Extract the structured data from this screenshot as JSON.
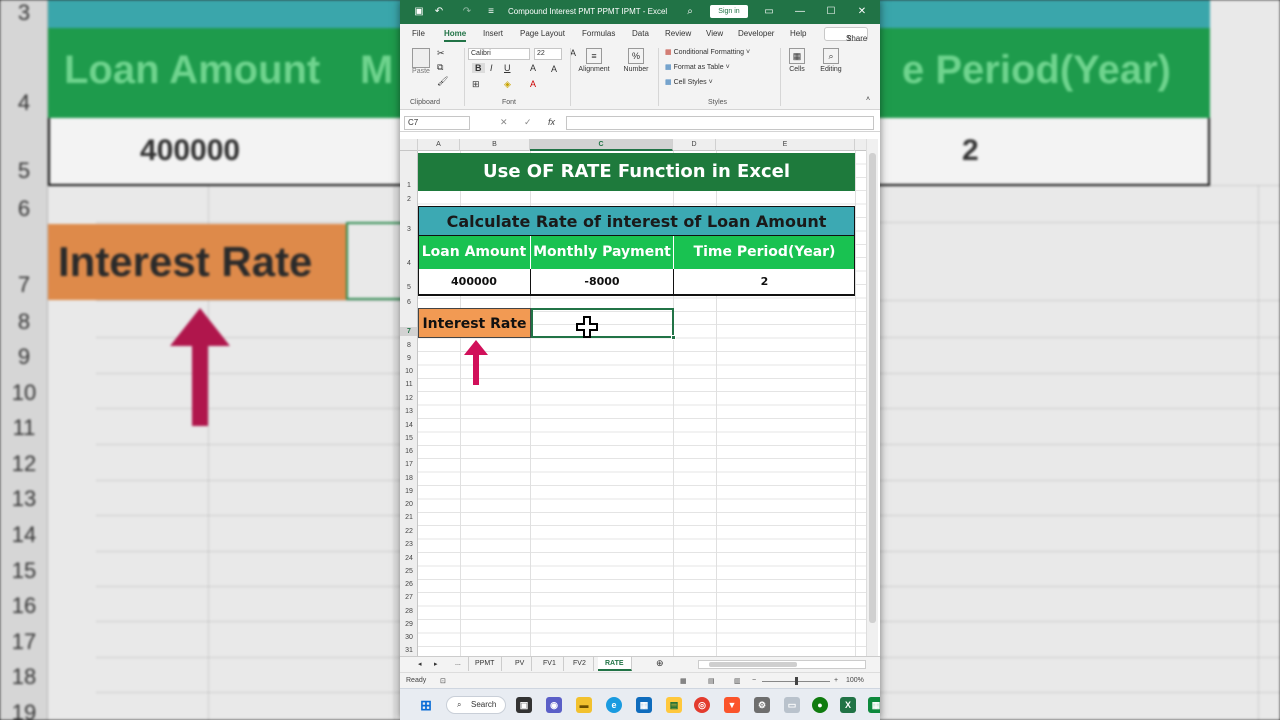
{
  "background": {
    "row_numbers": [
      "3",
      "4",
      "5",
      "6",
      "7",
      "8",
      "9",
      "10",
      "11",
      "12",
      "13",
      "14",
      "15",
      "16",
      "17",
      "18",
      "19"
    ],
    "headers": {
      "loan_amount": "Loan Amount",
      "monthly_partial": "M",
      "time_period_partial": "e Period(Year)"
    },
    "values": {
      "loan_amount": "400000",
      "time_period": "2"
    },
    "interest_label": "Interest Rate"
  },
  "window": {
    "title": "Compound Interest PMT PPMT IPMT  -  Excel",
    "sign_in": "Sign in",
    "menu": [
      "File",
      "Home",
      "Insert",
      "Page Layout",
      "Formulas",
      "Data",
      "Review",
      "View",
      "Developer",
      "Help"
    ],
    "active_menu": "Home",
    "share": "Share"
  },
  "ribbon": {
    "paste": "Paste",
    "clipboard": "Clipboard",
    "font_name": "Calibri",
    "font_size": "22",
    "font": "Font",
    "alignment": "Alignment",
    "number": "Number",
    "conditional_formatting": "Conditional Formatting",
    "format_as_table": "Format as Table",
    "cell_styles": "Cell Styles",
    "styles": "Styles",
    "cells": "Cells",
    "editing": "Editing"
  },
  "formula_bar": {
    "name_box": "C7",
    "fx": "fx",
    "value": ""
  },
  "columns": [
    "A",
    "B",
    "C",
    "D",
    "E"
  ],
  "rows": [
    "1",
    "2",
    "3",
    "4",
    "5",
    "6",
    "7",
    "8",
    "9",
    "10",
    "11",
    "12",
    "13",
    "14",
    "15",
    "16",
    "17",
    "18",
    "19",
    "20",
    "21",
    "22",
    "23",
    "24",
    "25",
    "26",
    "27",
    "28",
    "29",
    "30",
    "31"
  ],
  "sheet": {
    "title": "Use OF RATE Function in Excel",
    "subtitle": "Calculate Rate of interest of Loan Amount",
    "headers": [
      "Loan Amount",
      "Monthly Payment",
      "Time Period(Year)"
    ],
    "values": [
      "400000",
      "-8000",
      "2"
    ],
    "interest_label": "Interest Rate"
  },
  "tabs": {
    "ellipsis": "...",
    "items": [
      "PPMT",
      "PV",
      "FV1",
      "FV2",
      "RATE"
    ],
    "active": "RATE"
  },
  "status": {
    "ready": "Ready",
    "zoom": "100%"
  },
  "taskbar": {
    "search": "Search"
  },
  "colors": {
    "excel_green": "#217346",
    "title_green": "#1e7a3c",
    "teal": "#3ca9b3",
    "header_green": "#19c251",
    "orange": "#f29a53",
    "arrow": "#d1105a"
  }
}
